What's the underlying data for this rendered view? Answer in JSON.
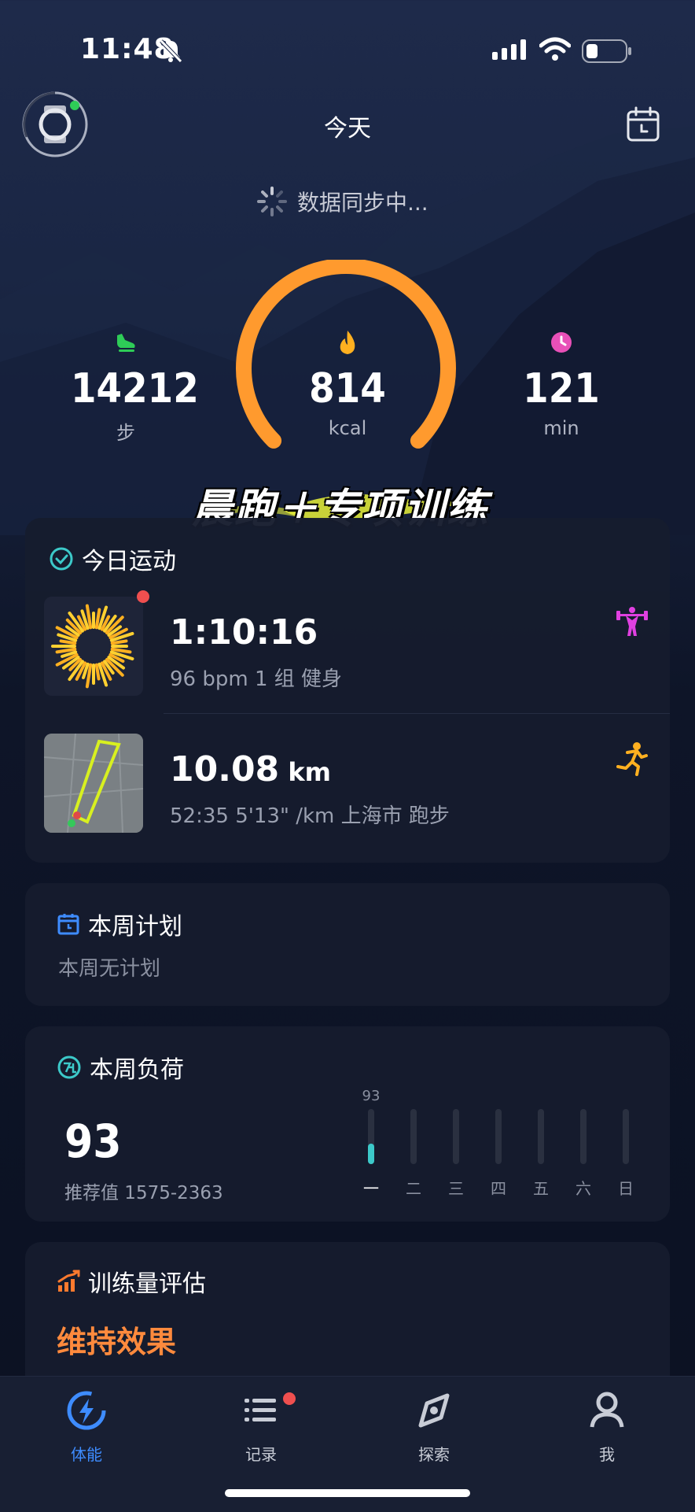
{
  "status": {
    "time": "11:48"
  },
  "header": {
    "title": "今天"
  },
  "sync": {
    "text": "数据同步中..."
  },
  "summary": {
    "steps": {
      "value": "14212",
      "unit": "步"
    },
    "calories": {
      "value": "814",
      "unit": "kcal",
      "ring_progress": 0.75
    },
    "minutes": {
      "value": "121",
      "unit": "min"
    }
  },
  "banner": {
    "text": "晨跑＋专项训练"
  },
  "today": {
    "title": "今日运动",
    "workouts": [
      {
        "main": "1:10:16",
        "main_unit": "",
        "sub": "96 bpm  1 组 健身",
        "type_icon": "weightlifting-icon"
      },
      {
        "main": "10.08",
        "main_unit": " km",
        "sub": "52:35  5'13\" /km 上海市 跑步",
        "type_icon": "running-icon"
      }
    ]
  },
  "plan": {
    "title": "本周计划",
    "empty": "本周无计划"
  },
  "load": {
    "title": "本周负荷",
    "value": "93",
    "recommend": "推荐值 1575-2363",
    "bar_top_label": "93",
    "days": [
      "一",
      "二",
      "三",
      "四",
      "五",
      "六",
      "日"
    ],
    "values": [
      93,
      0,
      0,
      0,
      0,
      0,
      0
    ]
  },
  "assessment": {
    "title": "训练量评估",
    "result": "维持效果"
  },
  "tabs": [
    {
      "label": "体能",
      "icon": "bolt-icon",
      "active": true
    },
    {
      "label": "记录",
      "icon": "list-icon",
      "active": false
    },
    {
      "label": "探索",
      "icon": "compass-icon",
      "active": false
    },
    {
      "label": "我",
      "icon": "person-icon",
      "active": false
    }
  ],
  "colors": {
    "ring": "#ff9a2e",
    "accent": "#3e8cff",
    "teal": "#3cc9c9",
    "assess": "#ff8a3d"
  }
}
